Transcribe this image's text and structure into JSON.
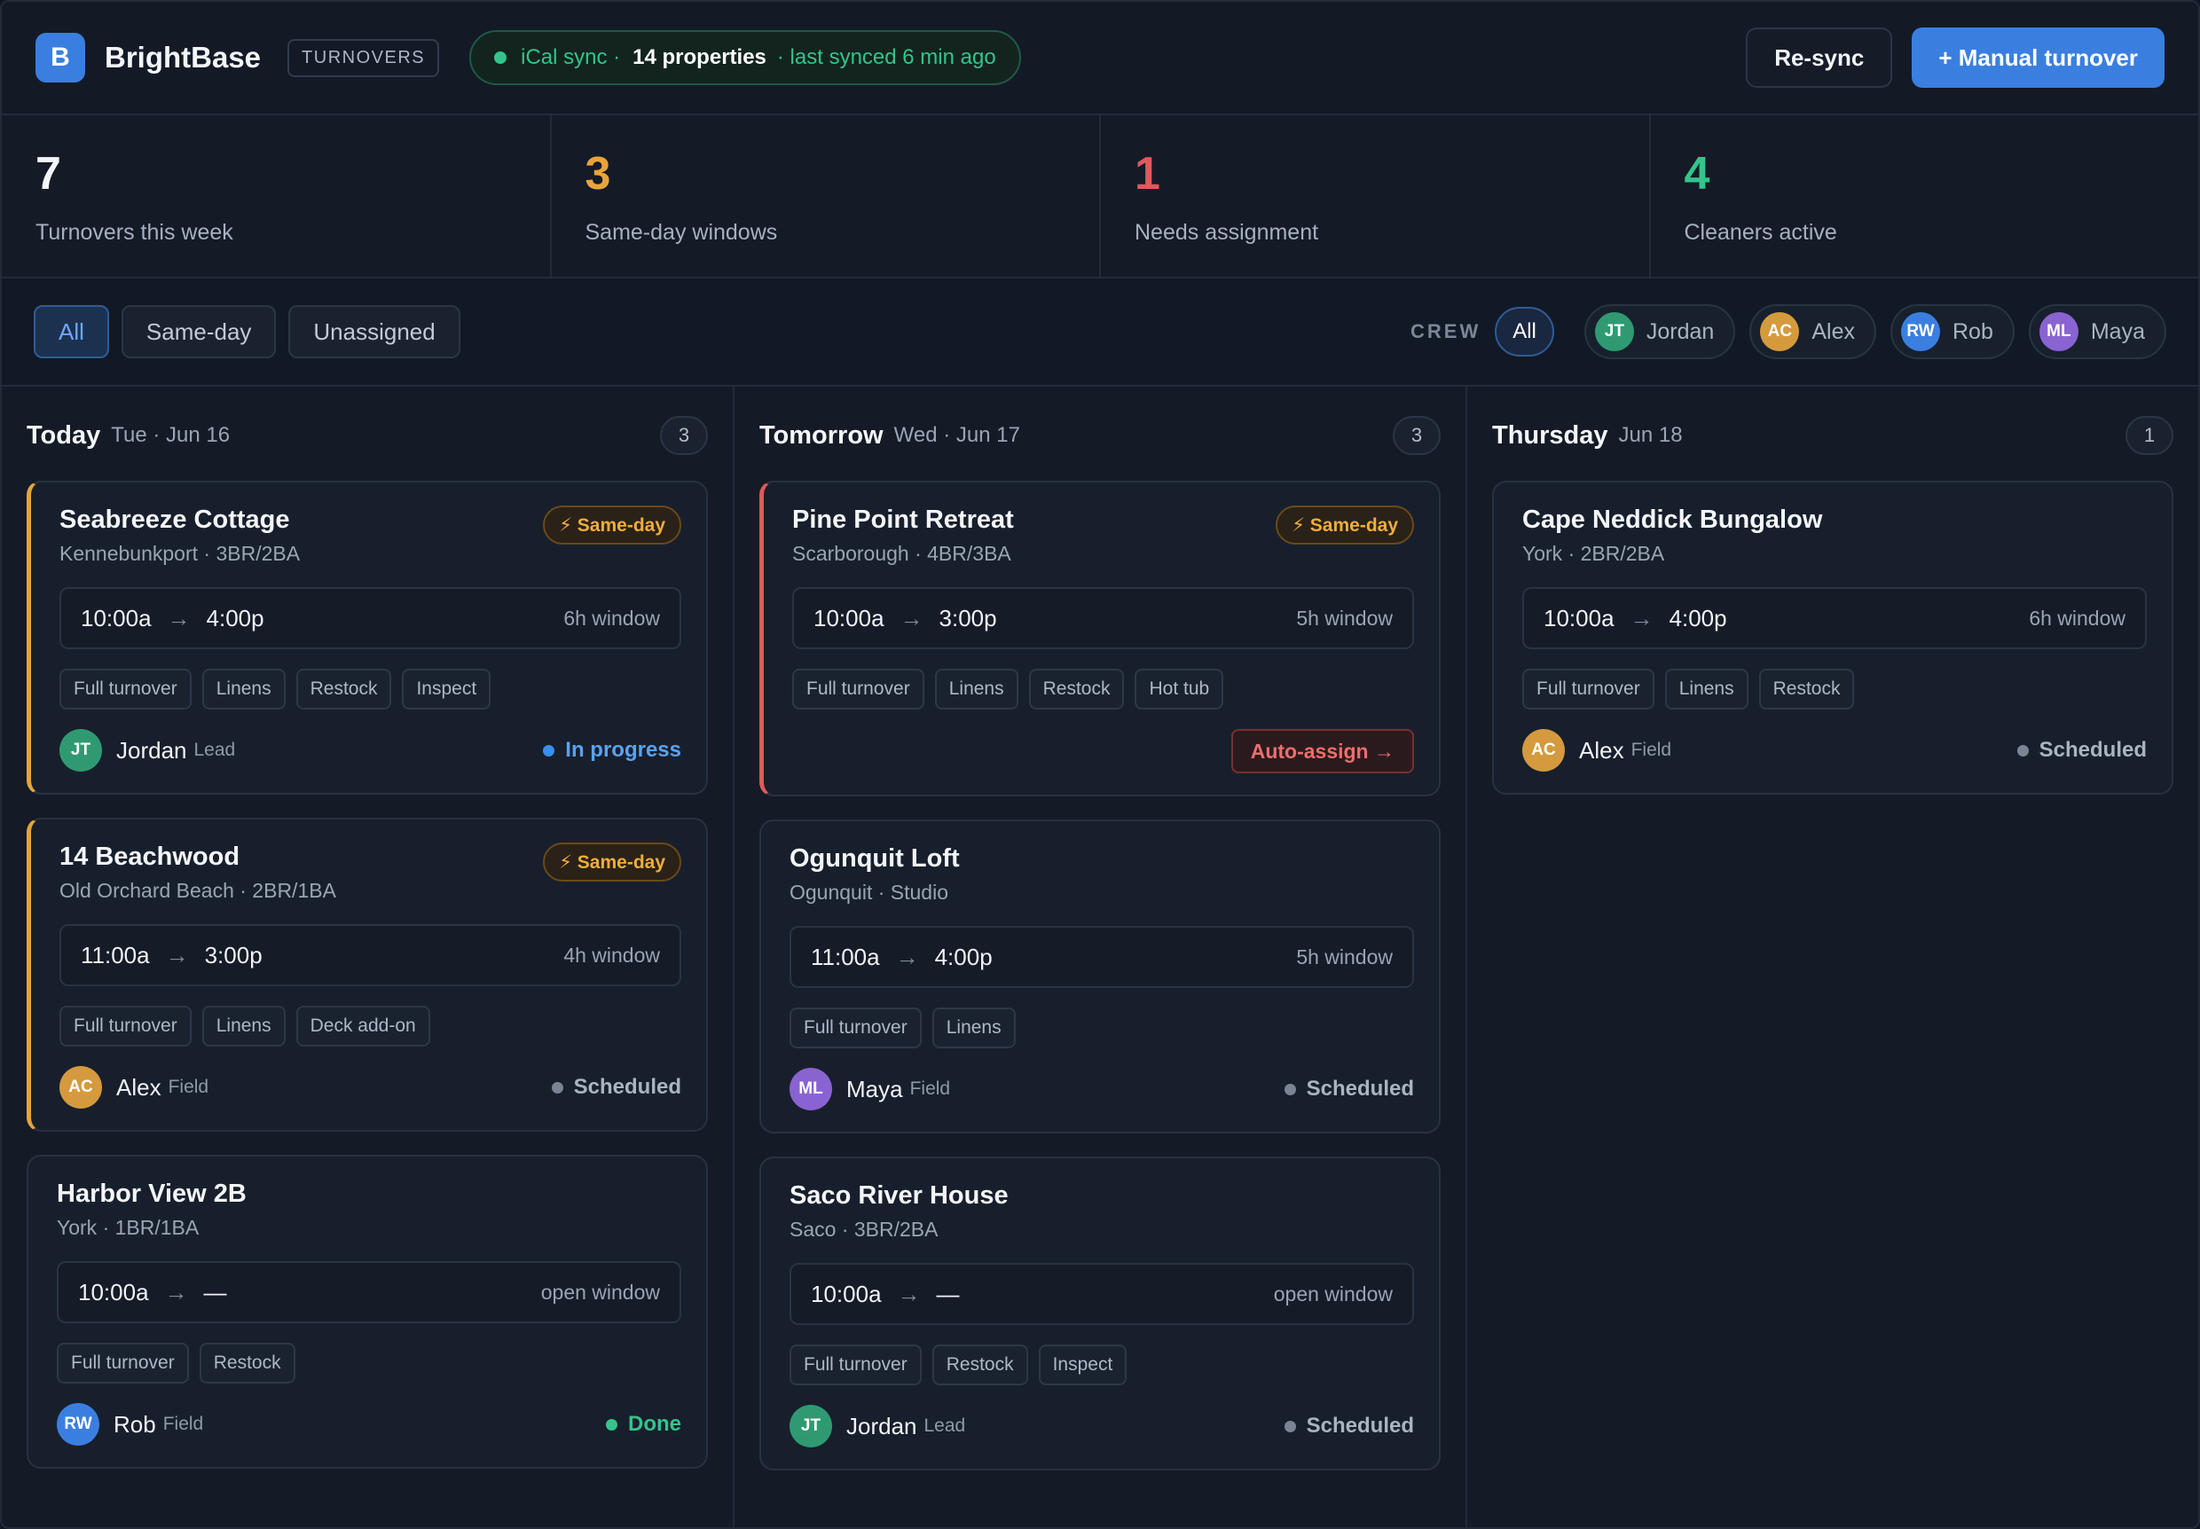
{
  "header": {
    "logo_letter": "B",
    "brand": "BrightBase",
    "section": "TURNOVERS",
    "sync": {
      "label": "iCal sync ·",
      "properties": "14 properties",
      "last": "· last synced 6 min ago"
    },
    "resync_label": "Re-sync",
    "manual_label": "+ Manual turnover"
  },
  "stats": [
    {
      "value": "7",
      "label": "Turnovers this week",
      "color": "#f2f5fa"
    },
    {
      "value": "3",
      "label": "Same-day windows",
      "color": "#e8a43c"
    },
    {
      "value": "1",
      "label": "Needs assignment",
      "color": "#e0595c"
    },
    {
      "value": "4",
      "label": "Cleaners active",
      "color": "#34c48b"
    }
  ],
  "filters": {
    "tabs": [
      "All",
      "Same-day",
      "Unassigned"
    ],
    "active_tab": "All",
    "crew_label": "CREW",
    "crew_all": "All",
    "crew": [
      {
        "initials": "JT",
        "name": "Jordan",
        "color": "#2f9a72"
      },
      {
        "initials": "AC",
        "name": "Alex",
        "color": "#d59a3e"
      },
      {
        "initials": "RW",
        "name": "Rob",
        "color": "#3a7fe0"
      },
      {
        "initials": "ML",
        "name": "Maya",
        "color": "#8a63d2"
      }
    ]
  },
  "columns": [
    {
      "day": "Today",
      "date": "Tue · Jun 16",
      "count": "3",
      "cards": [
        {
          "title": "Seabreeze Cottage",
          "sub": "Kennebunkport · 3BR/2BA",
          "same_day": "⚡ Same-day",
          "start": "10:00a",
          "end": "4:00p",
          "window": "6h window",
          "tags": [
            "Full turnover",
            "Linens",
            "Restock",
            "Inspect"
          ],
          "initials": "JT",
          "assignee": "Jordan",
          "role": "Lead",
          "status": "In progress"
        },
        {
          "title": "14 Beachwood",
          "sub": "Old Orchard Beach · 2BR/1BA",
          "same_day": "⚡ Same-day",
          "start": "11:00a",
          "end": "3:00p",
          "window": "4h window",
          "tags": [
            "Full turnover",
            "Linens",
            "Deck add-on"
          ],
          "initials": "AC",
          "assignee": "Alex",
          "role": "Field",
          "status": "Scheduled"
        },
        {
          "title": "Harbor View 2B",
          "sub": "York · 1BR/1BA",
          "start": "10:00a",
          "end": "—",
          "window": "open window",
          "tags": [
            "Full turnover",
            "Restock"
          ],
          "initials": "RW",
          "assignee": "Rob",
          "role": "Field",
          "status": "Done"
        }
      ]
    },
    {
      "day": "Tomorrow",
      "date": "Wed · Jun 17",
      "count": "3",
      "cards": [
        {
          "title": "Pine Point Retreat",
          "sub": "Scarborough · 4BR/3BA",
          "same_day": "⚡ Same-day",
          "start": "10:00a",
          "end": "3:00p",
          "window": "5h window",
          "tags": [
            "Full turnover",
            "Linens",
            "Restock",
            "Hot tub"
          ],
          "auto_assign": "Auto-assign →"
        },
        {
          "title": "Ogunquit Loft",
          "sub": "Ogunquit · Studio",
          "start": "11:00a",
          "end": "4:00p",
          "window": "5h window",
          "tags": [
            "Full turnover",
            "Linens"
          ],
          "initials": "ML",
          "assignee": "Maya",
          "role": "Field",
          "status": "Scheduled"
        },
        {
          "title": "Saco River House",
          "sub": "Saco · 3BR/2BA",
          "start": "10:00a",
          "end": "—",
          "window": "open window",
          "tags": [
            "Full turnover",
            "Restock",
            "Inspect"
          ],
          "initials": "JT",
          "assignee": "Jordan",
          "role": "Lead",
          "status": "Scheduled"
        }
      ]
    },
    {
      "day": "Thursday",
      "date": "Jun 18",
      "count": "1",
      "cards": [
        {
          "title": "Cape Neddick Bungalow",
          "sub": "York · 2BR/2BA",
          "start": "10:00a",
          "end": "4:00p",
          "window": "6h window",
          "tags": [
            "Full turnover",
            "Linens",
            "Restock"
          ],
          "initials": "AC",
          "assignee": "Alex",
          "role": "Field",
          "status": "Scheduled"
        }
      ]
    }
  ]
}
